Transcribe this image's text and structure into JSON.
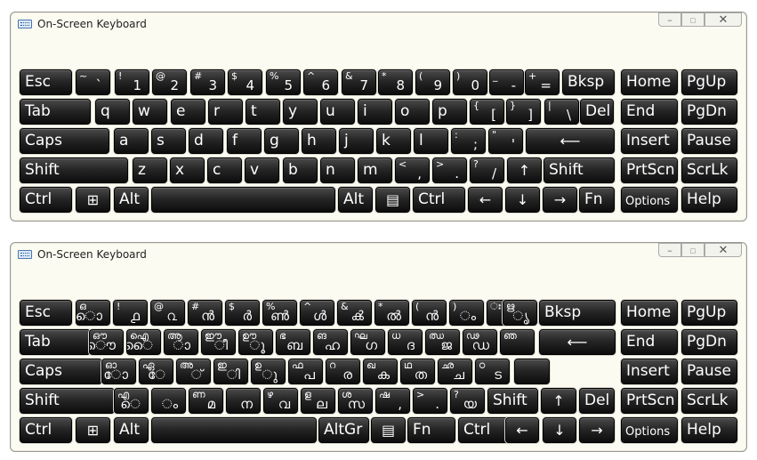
{
  "window_title": "On-Screen Keyboard",
  "window_buttons": {
    "minimize": "–",
    "maximize": "▫",
    "close": "✕"
  },
  "icons": {
    "app": "keyboard-icon",
    "windows": "windows-logo-icon",
    "menu": "context-menu-icon",
    "enter": "enter-arrow-icon"
  },
  "english": {
    "row1": [
      {
        "main": "Esc"
      },
      {
        "shift": "~",
        "base": "`"
      },
      {
        "shift": "!",
        "base": "1"
      },
      {
        "shift": "@",
        "base": "2"
      },
      {
        "shift": "#",
        "base": "3"
      },
      {
        "shift": "$",
        "base": "4"
      },
      {
        "shift": "%",
        "base": "5"
      },
      {
        "shift": "^",
        "base": "6"
      },
      {
        "shift": "&",
        "base": "7"
      },
      {
        "shift": "*",
        "base": "8"
      },
      {
        "shift": "(",
        "base": "9"
      },
      {
        "shift": ")",
        "base": "0"
      },
      {
        "shift": "_",
        "base": "-"
      },
      {
        "shift": "+",
        "base": "="
      },
      {
        "main": "Bksp"
      },
      {
        "main": "Home"
      },
      {
        "main": "PgUp"
      }
    ],
    "row2": [
      {
        "main": "Tab"
      },
      {
        "main": "q"
      },
      {
        "main": "w"
      },
      {
        "main": "e"
      },
      {
        "main": "r"
      },
      {
        "main": "t"
      },
      {
        "main": "y"
      },
      {
        "main": "u"
      },
      {
        "main": "i"
      },
      {
        "main": "o"
      },
      {
        "main": "p"
      },
      {
        "shift": "{",
        "base": "["
      },
      {
        "shift": "}",
        "base": "]"
      },
      {
        "shift": "|",
        "base": "\\"
      },
      {
        "main": "Del"
      },
      {
        "main": "End"
      },
      {
        "main": "PgDn"
      }
    ],
    "row3": [
      {
        "main": "Caps"
      },
      {
        "main": "a"
      },
      {
        "main": "s"
      },
      {
        "main": "d"
      },
      {
        "main": "f"
      },
      {
        "main": "g"
      },
      {
        "main": "h"
      },
      {
        "main": "j"
      },
      {
        "main": "k"
      },
      {
        "main": "l"
      },
      {
        "shift": ":",
        "base": ";"
      },
      {
        "shift": "\"",
        "base": "'"
      },
      {
        "main": "⟵"
      },
      {
        "main": "Insert"
      },
      {
        "main": "Pause"
      }
    ],
    "row4": [
      {
        "main": "Shift"
      },
      {
        "main": "z"
      },
      {
        "main": "x"
      },
      {
        "main": "c"
      },
      {
        "main": "v"
      },
      {
        "main": "b"
      },
      {
        "main": "n"
      },
      {
        "main": "m"
      },
      {
        "shift": "<",
        "base": ","
      },
      {
        "shift": ">",
        "base": "."
      },
      {
        "shift": "?",
        "base": "/"
      },
      {
        "main": "↑"
      },
      {
        "main": "Shift"
      },
      {
        "main": "PrtScn"
      },
      {
        "main": "ScrLk"
      }
    ],
    "row5": [
      {
        "main": "Ctrl"
      },
      {
        "main": "⊞"
      },
      {
        "main": "Alt"
      },
      {
        "main": ""
      },
      {
        "main": "Alt"
      },
      {
        "main": "▤"
      },
      {
        "main": "Ctrl"
      },
      {
        "main": "←"
      },
      {
        "main": "↓"
      },
      {
        "main": "→"
      },
      {
        "main": "Fn"
      },
      {
        "main": "Options"
      },
      {
        "main": "Help"
      }
    ]
  },
  "malayalam": {
    "row1": [
      {
        "main": "Esc"
      },
      {
        "shift": "ഒ",
        "base": "ൊ"
      },
      {
        "shift": "!",
        "base": "൧"
      },
      {
        "shift": "@",
        "base": "൨"
      },
      {
        "shift": "#",
        "base": "ൻ"
      },
      {
        "shift": "$",
        "base": "ർ"
      },
      {
        "shift": "%",
        "base": "ൺ"
      },
      {
        "shift": "^",
        "base": "ൾ"
      },
      {
        "shift": "&",
        "base": "ൿ"
      },
      {
        "shift": "*",
        "base": "ൽ"
      },
      {
        "shift": "(",
        "base": "ൻ"
      },
      {
        "shift": ")",
        "base": "ം"
      },
      {
        "shift": "ഃ",
        "base": "-"
      },
      {
        "shift": "ഋ",
        "base": "ൃ"
      },
      {
        "main": "Bksp"
      },
      {
        "main": "Home"
      },
      {
        "main": "PgUp"
      }
    ],
    "row2": [
      {
        "main": "Tab"
      },
      {
        "shift": "ഔ",
        "base": "ൌ"
      },
      {
        "shift": "ഐ",
        "base": "ൈ"
      },
      {
        "shift": "ആ",
        "base": "ാ"
      },
      {
        "shift": "ഈ",
        "base": "ീ"
      },
      {
        "shift": "ഊ",
        "base": "ൂ"
      },
      {
        "shift": "ഭ",
        "base": "ബ"
      },
      {
        "shift": "ങ",
        "base": "ഹ"
      },
      {
        "shift": "ഘ",
        "base": "ഗ"
      },
      {
        "shift": "ധ",
        "base": "ദ"
      },
      {
        "shift": "ഝ",
        "base": "ജ"
      },
      {
        "shift": "ഢ",
        "base": "ഡ"
      },
      {
        "shift": "ഞ",
        "base": ""
      },
      {
        "main": "⟵"
      },
      {
        "main": "End"
      },
      {
        "main": "PgDn"
      }
    ],
    "row3": [
      {
        "main": "Caps"
      },
      {
        "shift": "ഓ",
        "base": "ോ"
      },
      {
        "shift": "ഏ",
        "base": "േ"
      },
      {
        "shift": "അ",
        "base": "്"
      },
      {
        "shift": "ഇ",
        "base": "ി"
      },
      {
        "shift": "ഉ",
        "base": "ു"
      },
      {
        "shift": "ഫ",
        "base": "പ"
      },
      {
        "shift": "റ",
        "base": "ര"
      },
      {
        "shift": "ഖ",
        "base": "ക"
      },
      {
        "shift": "ഥ",
        "base": "ത"
      },
      {
        "shift": "ഛ",
        "base": "ച"
      },
      {
        "shift": "ഠ",
        "base": "ട"
      },
      {
        "main": ""
      },
      {
        "main": "Insert"
      },
      {
        "main": "Pause"
      }
    ],
    "row4": [
      {
        "main": "Shift"
      },
      {
        "shift": "എ",
        "base": "െ"
      },
      {
        "shift": "",
        "base": "ം"
      },
      {
        "shift": "ണ",
        "base": "മ"
      },
      {
        "shift": "",
        "base": "ന"
      },
      {
        "shift": "ഴ",
        "base": "വ"
      },
      {
        "shift": "ള",
        "base": "ല"
      },
      {
        "shift": "ശ",
        "base": "സ"
      },
      {
        "shift": "ഷ",
        "base": ","
      },
      {
        "shift": ">",
        "base": "."
      },
      {
        "shift": "?",
        "base": "യ"
      },
      {
        "main": "Shift"
      },
      {
        "main": "↑"
      },
      {
        "main": "Del"
      },
      {
        "main": "PrtScn"
      },
      {
        "main": "ScrLk"
      }
    ],
    "row5": [
      {
        "main": "Ctrl"
      },
      {
        "main": "⊞"
      },
      {
        "main": "Alt"
      },
      {
        "main": ""
      },
      {
        "main": "AltGr"
      },
      {
        "main": "▤"
      },
      {
        "main": "Fn"
      },
      {
        "main": "Ctrl"
      },
      {
        "main": "←"
      },
      {
        "main": "↓"
      },
      {
        "main": "→"
      },
      {
        "main": "Options"
      },
      {
        "main": "Help"
      }
    ]
  }
}
